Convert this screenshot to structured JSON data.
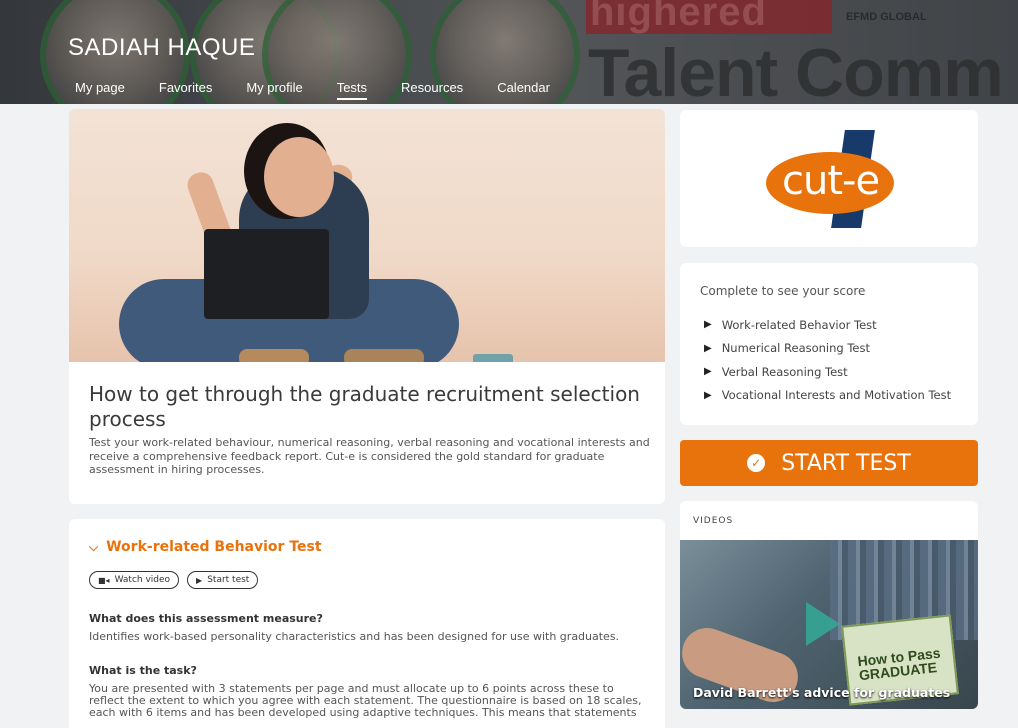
{
  "header": {
    "user_name": "SADIAH HAQUE",
    "banner_brand_text": "highered",
    "banner_partner_text": "EFMD GLOBAL",
    "banner_big_text": "Talent Comm",
    "nav": [
      {
        "label": "My page",
        "active": false
      },
      {
        "label": "Favorites",
        "active": false
      },
      {
        "label": "My profile",
        "active": false
      },
      {
        "label": "Tests",
        "active": true
      },
      {
        "label": "Resources",
        "active": false
      },
      {
        "label": "Calendar",
        "active": false
      }
    ]
  },
  "hero": {
    "title": "How to get through the graduate recruitment selection process",
    "description": "Test your work-related behaviour, numerical reasoning, verbal reasoning and vocational interests and receive a comprehensive feedback report. Cut-e is considered the gold standard for graduate assessment in hiring processes."
  },
  "detail": {
    "test_title": "Work-related Behavior Test",
    "watch_video_label": "Watch video",
    "start_test_label": "Start test",
    "q1_title": "What does this assessment measure?",
    "q1_text": "Identifies work-based personality characteristics and has been designed for use with graduates.",
    "q2_title": "What is the task?",
    "q2_text": "You are presented with 3 statements per page and must allocate up to 6 points across these to reflect the extent to which you agree with each statement. The questionnaire is based on 18 scales, each with 6 items and has been developed using adaptive techniques. This means that statements"
  },
  "sidebar": {
    "logo_text": "cut-e",
    "score_title": "Complete to see your score",
    "tests": [
      "Work-related Behavior Test",
      "Numerical Reasoning Test",
      "Verbal Reasoning Test",
      "Vocational Interests and Motivation Test"
    ],
    "start_button": "START TEST",
    "videos_label": "VIDEOS",
    "video_title": "David Barrett's advice for graduates",
    "video_book_text": "How to Pass GRADUATE"
  },
  "colors": {
    "accent": "#e8720c",
    "logo_stripe": "#183a6b"
  }
}
